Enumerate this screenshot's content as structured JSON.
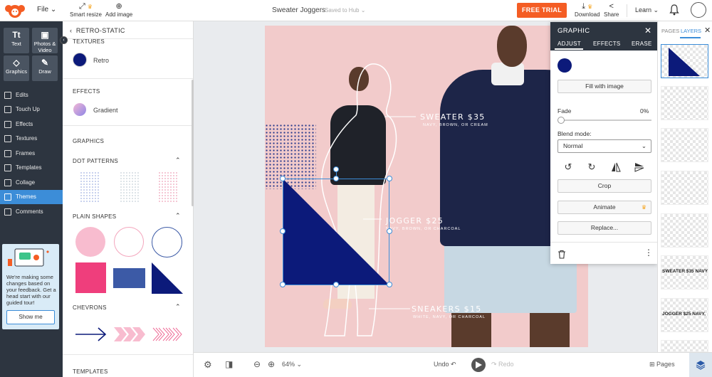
{
  "topbar": {
    "file_label": "File",
    "smart_resize_label": "Smart resize",
    "add_image_label": "Add image",
    "doc_title": "Sweater Joggers",
    "saved_status": "Saved to Hub",
    "free_trial_label": "FREE TRIAL",
    "download_label": "Download",
    "share_label": "Share",
    "learn_label": "Learn"
  },
  "sidebar": {
    "tools": [
      {
        "glyph": "Tt",
        "label": "Text"
      },
      {
        "glyph": "▣",
        "label": "Photos & Video"
      },
      {
        "glyph": "◇",
        "label": "Graphics"
      },
      {
        "glyph": "✎",
        "label": "Draw"
      }
    ],
    "items": [
      {
        "label": "Edits"
      },
      {
        "label": "Touch Up"
      },
      {
        "label": "Effects"
      },
      {
        "label": "Textures"
      },
      {
        "label": "Frames"
      },
      {
        "label": "Templates"
      },
      {
        "label": "Collage"
      },
      {
        "label": "Themes"
      },
      {
        "label": "Comments"
      }
    ],
    "active_item": "Themes",
    "tour": {
      "text": "We're making some changes based on your feedback. Get a head start with our guided tour!",
      "button_label": "Show me"
    }
  },
  "themes_panel": {
    "back_label": "RETRO-STATIC",
    "textures_heading": "TEXTURES",
    "texture_item": "Retro",
    "effects_heading": "EFFECTS",
    "effect_item": "Gradient",
    "graphics_heading": "GRAPHICS",
    "dot_patterns_heading": "DOT PATTERNS",
    "plain_shapes_heading": "PLAIN SHAPES",
    "chevrons_heading": "CHEVRONS",
    "templates_heading": "TEMPLATES"
  },
  "artboard": {
    "sweater_title": "SWEATER $35",
    "sweater_sub": "NAVY, BROWN, OR CREAM",
    "jogger_title": "JOGGER $25",
    "jogger_sub": "NAVY, BROWN, OR CHARCOAL",
    "sneakers_title": "SNEAKERS $15",
    "sneakers_sub": "WHITE, NAVY, OR CHARCOAL"
  },
  "graphic_panel": {
    "title": "GRAPHIC",
    "tabs": [
      "ADJUST",
      "EFFECTS",
      "ERASE"
    ],
    "active_tab": "ADJUST",
    "fill_label": "Fill with image",
    "fade_label": "Fade",
    "fade_value": "0%",
    "blend_label": "Blend mode:",
    "blend_value": "Normal",
    "crop_label": "Crop",
    "animate_label": "Animate",
    "replace_label": "Replace..."
  },
  "layers_panel": {
    "tab_pages": "PAGES",
    "tab_layers": "LAYERS",
    "layer_texts": [
      "SWEATER $35 NAVY",
      "JOGGER $25 NAVY,"
    ]
  },
  "bottombar": {
    "zoom": "64%",
    "undo_label": "Undo",
    "redo_label": "Redo",
    "pages_label": "Pages"
  },
  "colors": {
    "accent": "#3c8dd8",
    "navy": "#0c1a7a",
    "artboard_bg": "#f2cbcb",
    "free_trial": "#f45d24"
  }
}
